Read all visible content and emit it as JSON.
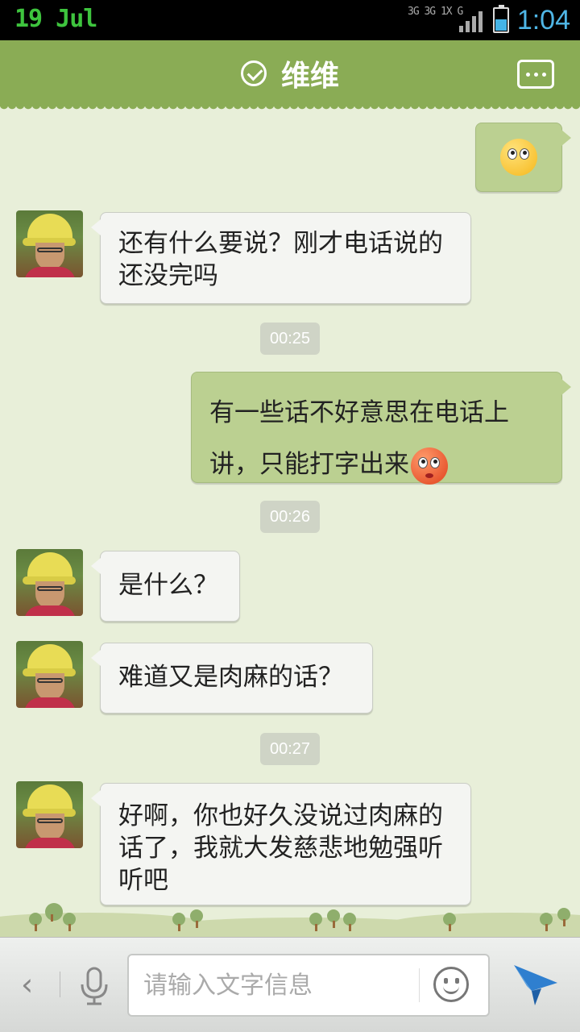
{
  "status_bar": {
    "date": "19  Jul",
    "network": "3G 3G 1X G",
    "time": "1:04"
  },
  "header": {
    "title": "维维"
  },
  "messages": [
    {
      "side": "right",
      "type": "emoji",
      "emoji": "shy-face"
    },
    {
      "side": "left",
      "text": "还有什么要说？刚才电话说的还没完吗"
    },
    {
      "side": "time",
      "text": "00:25"
    },
    {
      "side": "right",
      "text": "有一些话不好意思在电话上讲，只能打字出来",
      "emoji": "rolling-eyes-face"
    },
    {
      "side": "time",
      "text": "00:26"
    },
    {
      "side": "left",
      "text": "是什么？"
    },
    {
      "side": "left",
      "text": "难道又是肉麻的话？"
    },
    {
      "side": "time",
      "text": "00:27"
    },
    {
      "side": "left",
      "text": "好啊，你也好久没说过肉麻的话了，我就大发慈悲地勉强听听吧"
    }
  ],
  "input": {
    "placeholder": "请输入文字信息",
    "value": ""
  },
  "colors": {
    "header": "#8aac55",
    "background": "#e8efd9",
    "bubble_sent": "#bbd091",
    "bubble_received": "#f4f5f2",
    "send_accent": "#2f7fcf"
  }
}
